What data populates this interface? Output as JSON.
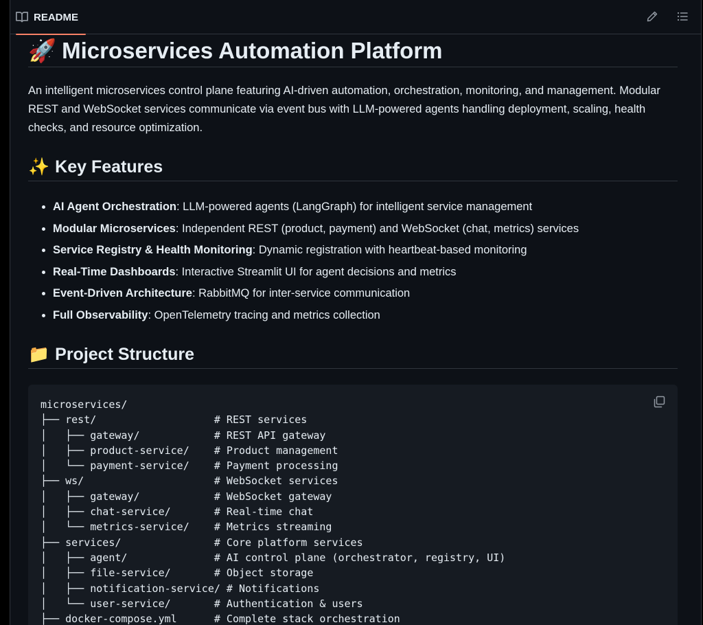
{
  "header": {
    "tab_label": "README",
    "edit_icon": "pencil-icon",
    "outline_icon": "list-icon"
  },
  "colors": {
    "background": "#0d1117",
    "border": "#30363d",
    "tab_accent": "#f78166",
    "code_background": "#161b22",
    "text": "#e6edf3",
    "muted": "#9198a1"
  },
  "readme": {
    "title_emoji": "🚀",
    "title": "Microservices Automation Platform",
    "intro": "An intelligent microservices control plane featuring AI-driven automation, orchestration, monitoring, and management. Modular REST and WebSocket services communicate via event bus with LLM-powered agents handling deployment, scaling, health checks, and resource optimization.",
    "features_emoji": "✨",
    "features_heading": "Key Features",
    "features": [
      {
        "name": "AI Agent Orchestration",
        "desc": ": LLM-powered agents (LangGraph) for intelligent service management"
      },
      {
        "name": "Modular Microservices",
        "desc": ": Independent REST (product, payment) and WebSocket (chat, metrics) services"
      },
      {
        "name": "Service Registry & Health Monitoring",
        "desc": ": Dynamic registration with heartbeat-based monitoring"
      },
      {
        "name": "Real-Time Dashboards",
        "desc": ": Interactive Streamlit UI for agent decisions and metrics"
      },
      {
        "name": "Event-Driven Architecture",
        "desc": ": RabbitMQ for inter-service communication"
      },
      {
        "name": "Full Observability",
        "desc": ": OpenTelemetry tracing and metrics collection"
      }
    ],
    "structure_emoji": "📁",
    "structure_heading": "Project Structure",
    "code_lines": [
      "microservices/",
      "├── rest/                   # REST services",
      "│   ├── gateway/            # REST API gateway",
      "│   ├── product-service/    # Product management",
      "│   └── payment-service/    # Payment processing",
      "├── ws/                     # WebSocket services",
      "│   ├── gateway/            # WebSocket gateway",
      "│   ├── chat-service/       # Real-time chat",
      "│   └── metrics-service/    # Metrics streaming",
      "├── services/               # Core platform services",
      "│   ├── agent/              # AI control plane (orchestrator, registry, UI)",
      "│   ├── file-service/       # Object storage",
      "│   ├── notification-service/ # Notifications",
      "│   └── user-service/       # Authentication & users",
      "├── docker-compose.yml      # Complete stack orchestration"
    ],
    "copy_icon": "copy-icon"
  }
}
